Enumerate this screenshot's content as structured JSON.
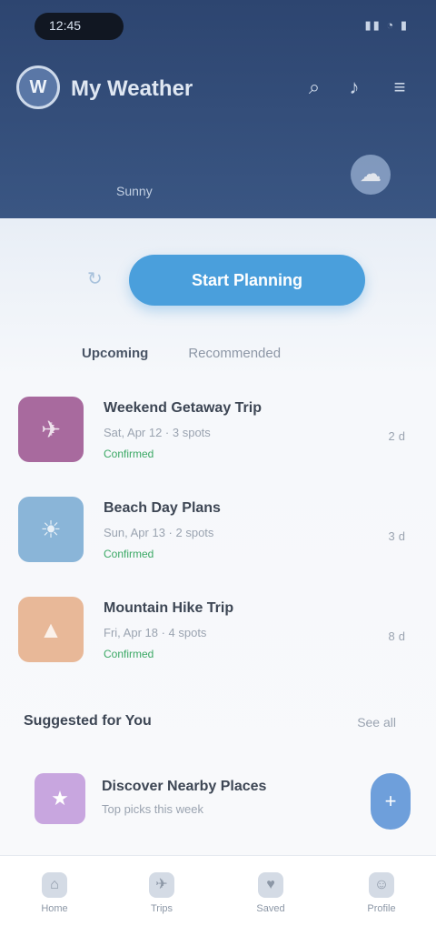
{
  "status": {
    "time": "12:45",
    "icons": "▮▮ ◔ ▮"
  },
  "app": {
    "title": "My Weather",
    "logo_letter": "W"
  },
  "appbar": {
    "icons": [
      {
        "name": "search-icon",
        "glyph": "⌕"
      },
      {
        "name": "bell-icon",
        "glyph": "♪"
      },
      {
        "name": "menu-icon",
        "glyph": "≡"
      }
    ]
  },
  "weather": {
    "label": "Sunny",
    "icon": "cloud-sun-icon"
  },
  "primary_action": {
    "label": "Start Planning",
    "glyph": "↻"
  },
  "tabs": [
    {
      "label": "Upcoming",
      "active": true
    },
    {
      "label": "Recommended",
      "active": false
    }
  ],
  "items": [
    {
      "title": "Weekend Getaway Trip",
      "subtitle": "Sat, Apr 12 · 3 spots",
      "status": "Confirmed",
      "meta": "2d",
      "color": "#a86a9e",
      "glyph": "✈"
    },
    {
      "title": "Beach Day Plans",
      "subtitle": "Sun, Apr 13 · 2 spots",
      "status": "Confirmed",
      "meta": "3d",
      "color": "#8ab5d8",
      "glyph": "☀"
    },
    {
      "title": "Mountain Hike Trip",
      "subtitle": "Fri, Apr 18 · 4 spots",
      "status": "Confirmed",
      "meta": "8d",
      "color": "#e8b898",
      "glyph": "▲"
    }
  ],
  "section": {
    "title": "Suggested for You",
    "link": "See all"
  },
  "promo": {
    "title": "Discover Nearby Places",
    "subtitle": "Top picks this week",
    "glyph": "★",
    "fab_glyph": "+"
  },
  "nav": [
    {
      "label": "Home",
      "glyph": "⌂",
      "name": "home"
    },
    {
      "label": "Trips",
      "glyph": "✈",
      "name": "trips"
    },
    {
      "label": "Saved",
      "glyph": "♥",
      "name": "saved"
    },
    {
      "label": "Profile",
      "glyph": "☺",
      "name": "profile"
    }
  ],
  "colors": {
    "header": "#2d4570",
    "accent": "#4a9fdc",
    "success": "#3aa864"
  }
}
